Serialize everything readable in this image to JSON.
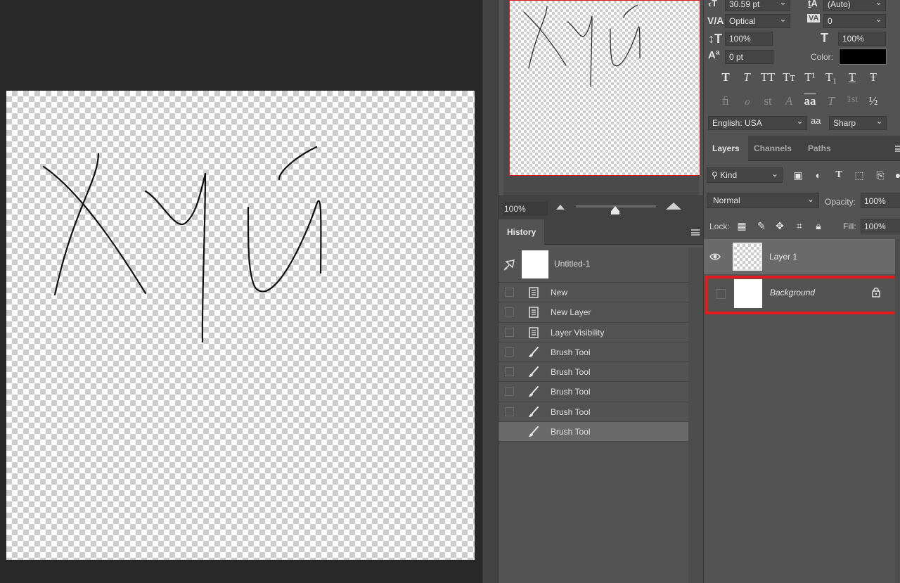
{
  "canvas": {
    "drawing_text": "Хуй"
  },
  "navigator": {
    "zoom_value": "100%"
  },
  "character": {
    "font_size": "30.59 pt",
    "leading": "(Auto)",
    "kerning": "Optical",
    "tracking": "0",
    "vertical_scale": "100%",
    "horizontal_scale": "100%",
    "baseline_shift": "0 pt",
    "color_label": "Color:",
    "color_value": "#000000",
    "language": "English: USA",
    "antialias_icon_text": "aa",
    "antialias": "Sharp",
    "type_buttons": [
      "T",
      "T",
      "TT",
      "Tт",
      "T¹",
      "T₁",
      "T",
      "Ŧ"
    ],
    "opentype_buttons": [
      "ﬁ",
      "ℴ",
      "st",
      "A",
      "aa",
      "T",
      "1st",
      "½"
    ]
  },
  "history": {
    "tab_label": "History",
    "snapshot_label": "Untitled-1",
    "items": [
      {
        "label": "New",
        "icon": "document-icon"
      },
      {
        "label": "New Layer",
        "icon": "document-icon"
      },
      {
        "label": "Layer Visibility",
        "icon": "document-icon"
      },
      {
        "label": "Brush Tool",
        "icon": "brush-icon"
      },
      {
        "label": "Brush Tool",
        "icon": "brush-icon"
      },
      {
        "label": "Brush Tool",
        "icon": "brush-icon"
      },
      {
        "label": "Brush Tool",
        "icon": "brush-icon"
      },
      {
        "label": "Brush Tool",
        "icon": "brush-icon",
        "selected": true
      }
    ]
  },
  "layers_panel": {
    "tabs": [
      "Layers",
      "Channels",
      "Paths"
    ],
    "kind_label": "Kind",
    "blend_mode": "Normal",
    "opacity_label": "Opacity:",
    "opacity_value": "100%",
    "lock_label": "Lock:",
    "fill_label": "Fill:",
    "fill_value": "100%",
    "layers": [
      {
        "name": "Layer 1",
        "visible": true,
        "selected": true
      },
      {
        "name": "Background",
        "visible": false,
        "locked": true,
        "highlighted": true
      }
    ]
  },
  "colors": {
    "panel_bg": "#535353",
    "workspace_bg": "#282828",
    "highlight_red": "#e31b1b",
    "selected_row": "#6a6a6a"
  }
}
